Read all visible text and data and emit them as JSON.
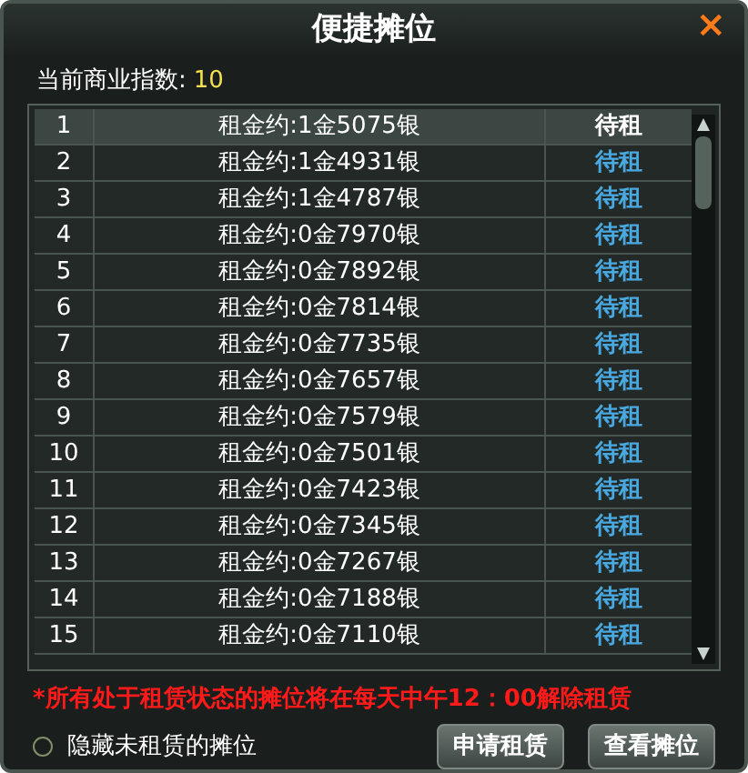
{
  "window": {
    "title": "便捷摊位",
    "close": "×"
  },
  "index": {
    "label": "当前商业指数:",
    "value": "10"
  },
  "rows": [
    {
      "no": "1",
      "rent": "租金约:1金5075银",
      "status": "待租",
      "selected": true
    },
    {
      "no": "2",
      "rent": "租金约:1金4931银",
      "status": "待租",
      "selected": false
    },
    {
      "no": "3",
      "rent": "租金约:1金4787银",
      "status": "待租",
      "selected": false
    },
    {
      "no": "4",
      "rent": "租金约:0金7970银",
      "status": "待租",
      "selected": false
    },
    {
      "no": "5",
      "rent": "租金约:0金7892银",
      "status": "待租",
      "selected": false
    },
    {
      "no": "6",
      "rent": "租金约:0金7814银",
      "status": "待租",
      "selected": false
    },
    {
      "no": "7",
      "rent": "租金约:0金7735银",
      "status": "待租",
      "selected": false
    },
    {
      "no": "8",
      "rent": "租金约:0金7657银",
      "status": "待租",
      "selected": false
    },
    {
      "no": "9",
      "rent": "租金约:0金7579银",
      "status": "待租",
      "selected": false
    },
    {
      "no": "10",
      "rent": "租金约:0金7501银",
      "status": "待租",
      "selected": false
    },
    {
      "no": "11",
      "rent": "租金约:0金7423银",
      "status": "待租",
      "selected": false
    },
    {
      "no": "12",
      "rent": "租金约:0金7345银",
      "status": "待租",
      "selected": false
    },
    {
      "no": "13",
      "rent": "租金约:0金7267银",
      "status": "待租",
      "selected": false
    },
    {
      "no": "14",
      "rent": "租金约:0金7188银",
      "status": "待租",
      "selected": false
    },
    {
      "no": "15",
      "rent": "租金约:0金7110银",
      "status": "待租",
      "selected": false
    }
  ],
  "notice": "*所有处于租赁状态的摊位将在每天中午12：00解除租赁",
  "hide_option": {
    "label": "隐藏未租赁的摊位",
    "checked": false
  },
  "buttons": [
    "申请租赁",
    "查看摊位"
  ]
}
